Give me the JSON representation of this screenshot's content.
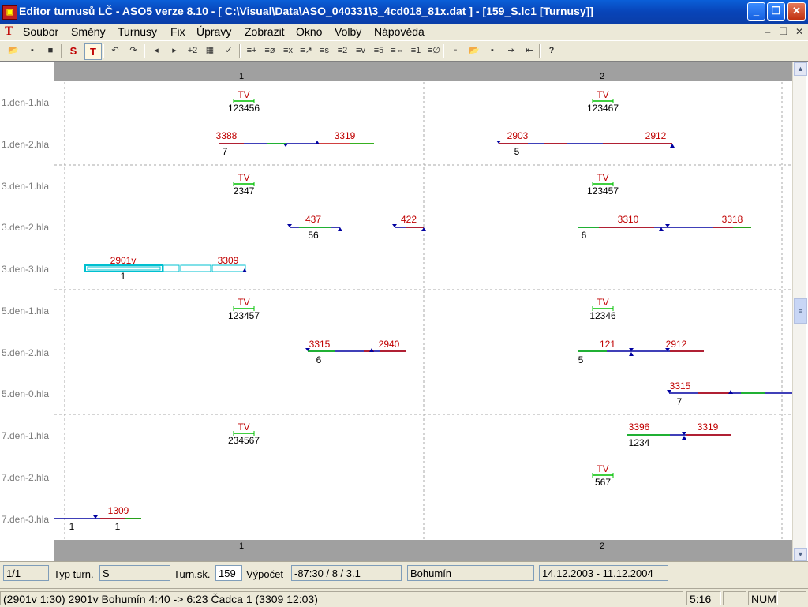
{
  "window": {
    "title": "Editor turnusů LČ - ASO5 verze 8.10 - [ C:\\Visual\\Data\\ASO_040331\\3_4cd018_81x.dat ] - [159_S.lc1 [Turnusy]]",
    "icon": "app-icon",
    "minimize_symbol": "_",
    "maximize_symbol": "❐",
    "close_symbol": "✕"
  },
  "menu": {
    "logo": "T",
    "items": [
      "Soubor",
      "Směny",
      "Turnusy",
      "Fix",
      "Úpravy",
      "Zobrazit",
      "Okno",
      "Volby",
      "Nápověda"
    ],
    "mdi_minimize": "–",
    "mdi_restore": "❐",
    "mdi_close": "✕"
  },
  "toolbar": {
    "tools": [
      {
        "icon": "open-folder-icon",
        "glyph": "📂"
      },
      {
        "icon": "save-icon",
        "glyph": "▪"
      },
      {
        "icon": "train-icon",
        "glyph": "■"
      },
      {
        "icon": "s-icon",
        "glyph": "S"
      },
      {
        "icon": "t-icon",
        "glyph": "T"
      },
      {
        "icon": "undo-icon",
        "glyph": "↶"
      },
      {
        "icon": "redo-icon",
        "glyph": "↷"
      },
      {
        "icon": "prev-icon",
        "glyph": "◂"
      },
      {
        "icon": "next-icon",
        "glyph": "▸"
      },
      {
        "icon": "plus-two-icon",
        "glyph": "+2"
      },
      {
        "icon": "grid-icon",
        "glyph": "▦"
      },
      {
        "icon": "check-list-icon",
        "glyph": "✓"
      },
      {
        "icon": "list-add-icon",
        "glyph": "≡+"
      },
      {
        "icon": "list-zero-icon",
        "glyph": "≡ø"
      },
      {
        "icon": "list-delete-icon",
        "glyph": "≡x"
      },
      {
        "icon": "list-edit-icon",
        "glyph": "≡↗"
      },
      {
        "icon": "list-sort-icon",
        "glyph": "≡s"
      },
      {
        "icon": "list-two-icon",
        "glyph": "≡2"
      },
      {
        "icon": "list-check-icon",
        "glyph": "≡v"
      },
      {
        "icon": "list-five-icon",
        "glyph": "≡5"
      },
      {
        "icon": "list-merge-icon",
        "glyph": "≡⇔"
      },
      {
        "icon": "list-one-icon",
        "glyph": "≡1"
      },
      {
        "icon": "list-disabled-icon",
        "glyph": "≡∅"
      },
      {
        "icon": "tree-icon",
        "glyph": "⊦"
      },
      {
        "icon": "open-icon",
        "glyph": "📂"
      },
      {
        "icon": "disk-icon",
        "glyph": "▪"
      },
      {
        "icon": "export-icon",
        "glyph": "⇥"
      },
      {
        "icon": "import-icon",
        "glyph": "⇤"
      },
      {
        "icon": "help-icon",
        "glyph": "?"
      }
    ]
  },
  "rows": [
    "1.den-1.hla",
    "1.den-2.hla",
    "3.den-1.hla",
    "3.den-2.hla",
    "3.den-3.hla",
    "5.den-1.hla",
    "5.den-2.hla",
    "5.den-0.hla",
    "7.den-1.hla",
    "7.den-2.hla",
    "7.den-3.hla"
  ],
  "columns": [
    "1",
    "2"
  ],
  "gantt_items": [
    {
      "label": "TV",
      "days": "123456"
    },
    {
      "label": "TV",
      "days": "123467"
    },
    {
      "labels": [
        "3388",
        "3319"
      ],
      "count": "7"
    },
    {
      "labels": [
        "2903",
        "2912"
      ],
      "count": "5"
    },
    {
      "label": "TV",
      "days": "2347"
    },
    {
      "label": "TV",
      "days": "123457"
    },
    {
      "labels": [
        "437"
      ],
      "count": "56"
    },
    {
      "labels": [
        "422"
      ],
      "count": ""
    },
    {
      "labels": [
        "3310",
        "3318"
      ],
      "count": "6"
    },
    {
      "labels": [
        "2901v",
        "3309"
      ],
      "count": "1"
    },
    {
      "label": "TV",
      "days": "123457"
    },
    {
      "label": "TV",
      "days": "12346"
    },
    {
      "labels": [
        "3315",
        "2940"
      ],
      "count": "6"
    },
    {
      "labels": [
        "121",
        "2912"
      ],
      "count": "5"
    },
    {
      "labels": [
        "3315"
      ],
      "count": "7"
    },
    {
      "label": "TV",
      "days": "234567"
    },
    {
      "labels": [
        "3396",
        "3319"
      ],
      "count": "1234"
    },
    {
      "label": "TV",
      "days": "567"
    },
    {
      "labels": [
        "1309"
      ],
      "count": "1"
    },
    {
      "labels": [],
      "count": "1"
    }
  ],
  "colors": {
    "train_label": "#c00000",
    "blue": "#0000a0",
    "green": "#00c000",
    "selection": "#00c0d0"
  },
  "status": {
    "page": "1/1",
    "typ_label": "Typ turn.",
    "typ_value": "S",
    "turnsk_label": "Turn.sk.",
    "turnsk_value": "159",
    "vypocet_label": "Výpočet",
    "vypocet_value": "-87:30 / 8 / 3.1",
    "station": "Bohumín",
    "validity": "14.12.2003 - 11.12.2004"
  },
  "infobar": {
    "detail": "(2901v  1:30)  2901v  Bohumín  4:40  ->  6:23  Čadca  1  (3309  12:03)",
    "time": "5:16",
    "blank": "",
    "num": "NUM",
    "blank2": ""
  }
}
